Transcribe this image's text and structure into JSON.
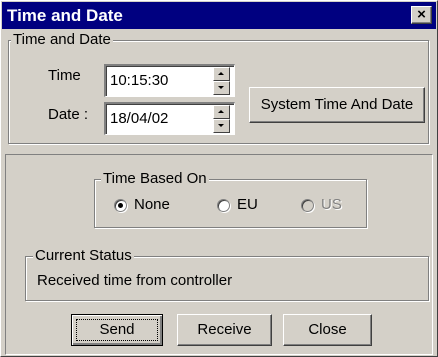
{
  "window": {
    "title": "Time and Date",
    "close_glyph": "×"
  },
  "time_date_group": {
    "legend": "Time and Date",
    "time_label": "Time",
    "time_value": "10:15:30",
    "date_label": "Date :",
    "date_value": "18/04/02",
    "system_button": "System Time And Date"
  },
  "time_based_on": {
    "legend": "Time Based On",
    "options": [
      {
        "label": "None",
        "selected": true,
        "enabled": true
      },
      {
        "label": "EU",
        "selected": false,
        "enabled": true
      },
      {
        "label": "US",
        "selected": false,
        "enabled": false
      }
    ]
  },
  "current_status": {
    "legend": "Current Status",
    "text": "Received time from controller"
  },
  "buttons": {
    "send": "Send",
    "receive": "Receive",
    "close": "Close"
  },
  "icons": {
    "close": "close-icon",
    "spin_up": "arrow-up-icon",
    "spin_down": "arrow-down-icon"
  }
}
